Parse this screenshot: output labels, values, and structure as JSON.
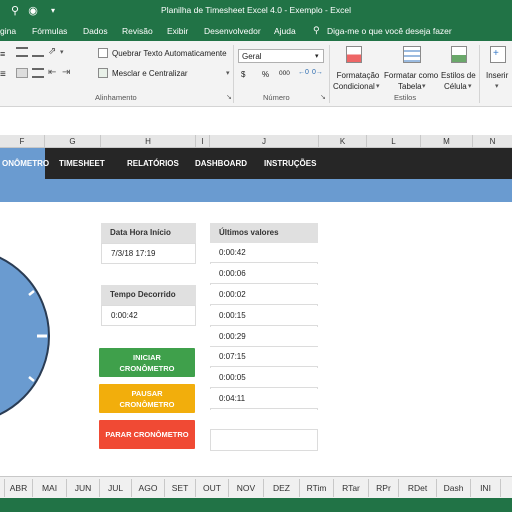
{
  "titlebar": {
    "title": "Planilha de Timesheet Excel 4.0 - Exemplo  -  Excel"
  },
  "menu": {
    "items": [
      "gina",
      "Fórmulas",
      "Dados",
      "Revisão",
      "Exibir",
      "Desenvolvedor",
      "Ajuda"
    ],
    "tell_me": "Diga-me o que você deseja fazer"
  },
  "ribbon": {
    "wrap_text": "Quebrar Texto Automaticamente",
    "merge_center": "Mesclar e Centralizar",
    "alignment_group": "Alinhamento",
    "number_format": "Geral",
    "number_group": "Número",
    "conditional_formatting": [
      "Formatação",
      "Condicional"
    ],
    "format_as_table": [
      "Formatar como",
      "Tabela"
    ],
    "cell_styles": [
      "Estilos de",
      "Célula"
    ],
    "styles_group": "Estilos",
    "insert": "Inserir",
    "number_symbols": [
      "$",
      "%",
      "000",
      "⁰⁰",
      "⁰⁰"
    ]
  },
  "columns": [
    "F",
    "G",
    "H",
    "I",
    "J",
    "K",
    "L",
    "M",
    "N"
  ],
  "nav": [
    "ONÔMETRO",
    "TIMESHEET",
    "RELATÓRIOS",
    "DASHBOARD",
    "INSTRUÇÕES"
  ],
  "start": {
    "label": "Data Hora Início",
    "value": "7/3/18 17:19"
  },
  "elapsed": {
    "label": "Tempo Decorrido",
    "value": "0:00:42"
  },
  "buttons": {
    "start": [
      "INICIAR",
      "CRONÔMETRO"
    ],
    "pause": [
      "PAUSAR",
      "CRONÔMETRO"
    ],
    "stop": "PARAR CRONÔMETRO"
  },
  "last_values": {
    "label": "Últimos valores",
    "values": [
      "0:00:42",
      "0:00:06",
      "0:00:02",
      "0:00:15",
      "0:00:29",
      "0:07:15",
      "0:00:05",
      "0:04:11",
      ""
    ]
  },
  "sheets": [
    "ABR",
    "MAI",
    "JUN",
    "JUL",
    "AGO",
    "SET",
    "OUT",
    "NOV",
    "DEZ",
    "RTim",
    "RTar",
    "RPr",
    "RDet",
    "Dash",
    "INI"
  ],
  "colors": {
    "excel_green": "#217346",
    "nav_dark": "#262626",
    "accent_blue": "#6a9bd0",
    "start_green": "#3fa04b",
    "pause_orange": "#f2ae0c",
    "stop_red": "#f04a34"
  }
}
